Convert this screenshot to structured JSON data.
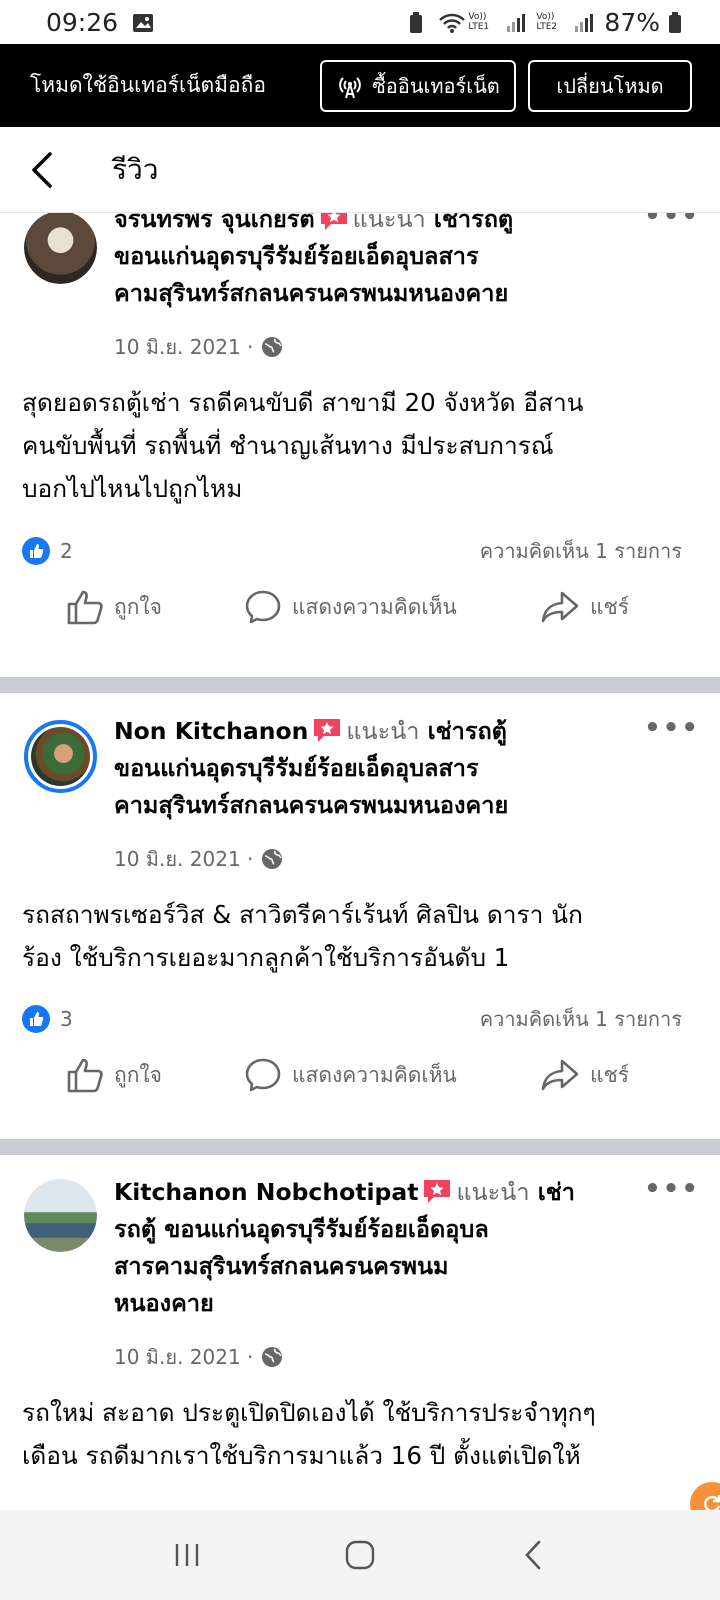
{
  "status_bar": {
    "time": "09:26",
    "lte1": "Vo)) LTE1",
    "lte2": "Vo)) LTE2",
    "battery": "87%"
  },
  "banner": {
    "mode_text": "โหมดใช้อินเทอร์เน็ตมือถือ",
    "buy_label": "ซื้ออินเทอร์เน็ต",
    "switch_label": "เปลี่ยนโหมด"
  },
  "header": {
    "title": "รีวิว"
  },
  "reviews": [
    {
      "name": "จรินทร์พร จุนเกียรติ",
      "recommends": "แนะนำ",
      "page": "เช่ารถตู้ขอนแก่นอุดรบุรีรัมย์ร้อยเอ็ดอุบลสารคามสุรินทร์สกลนครนครพนมหนองคาย",
      "date": "10 มิ.ย. 2021 ·",
      "text": "สุดยอดรถตู้เช่า รถดีคนขับดี สาขามี 20 จังหวัด อีสาน คนขับพื้นที่ รถพื้นที่ ชำนาญเส้นทาง มีประสบการณ์ บอกไปไหนไปถูกไหม",
      "likes": "2",
      "comments": "ความคิดเห็น 1 รายการ",
      "head_l1": "จรินทร์พร จุนเกียรติ",
      "head_l1b": "เช่ารถตู้",
      "head_l2": "ขอนแก่นอุดรบุรีรัมย์ร้อยเอ็ดอุบลสาร",
      "head_l3": "คามสุรินทร์สกลนครนครพนมหนองคาย",
      "body_l1": "สุดยอดรถตู้เช่า รถดีคนขับดี สาขามี 20 จังหวัด อีสาน",
      "body_l2": "คนขับพื้นที่ รถพื้นที่ ชำนาญเส้นทาง มีประสบการณ์",
      "body_l3": "บอกไปไหนไปถูกไหม"
    },
    {
      "name": "Non Kitchanon",
      "recommends": "แนะนำ",
      "head_l1b": "เช่ารถตู้",
      "head_l2": "ขอนแก่นอุดรบุรีรัมย์ร้อยเอ็ดอุบลสาร",
      "head_l3": "คามสุรินทร์สกลนครนครพนมหนองคาย",
      "date": "10 มิ.ย. 2021 ·",
      "body_l1": "รถสถาพรเซอร์วิส & สาวิตรีคาร์เร้นท์ ศิลปิน ดารา นัก",
      "body_l2": "ร้อง ใช้บริการเยอะมากลูกค้าใช้บริการอันดับ 1",
      "likes": "3",
      "comments": "ความคิดเห็น 1 รายการ"
    },
    {
      "name": "Kitchanon Nobchotipat",
      "recommends": "แนะนำ",
      "head_l1b": "เช่า",
      "head_l2": "รถตู้ ขอนแก่นอุดรบุรีรัมย์ร้อยเอ็ดอุบล",
      "head_l3": "สารคามสุรินทร์สกลนครนครพนม",
      "head_l4": "หนองคาย",
      "date": "10 มิ.ย. 2021 ·",
      "body_l1": "รถใหม่ สะอาด ประตูเปิดปิดเองได้ ใช้บริการประจำทุกๆ",
      "body_l2": "เดือน รถดีมากเราใช้บริการมาแล้ว 16 ปี ตั้งแต่เปิดให้"
    }
  ],
  "actions": {
    "like": "ถูกใจ",
    "comment": "แสดงความคิดเห็น",
    "share": "แชร์"
  },
  "colors": {
    "accent": "#1877f2",
    "banner_bg": "#000000",
    "separator": "#c9ccd1",
    "muted": "#65676b",
    "fab": "#f7923a"
  }
}
